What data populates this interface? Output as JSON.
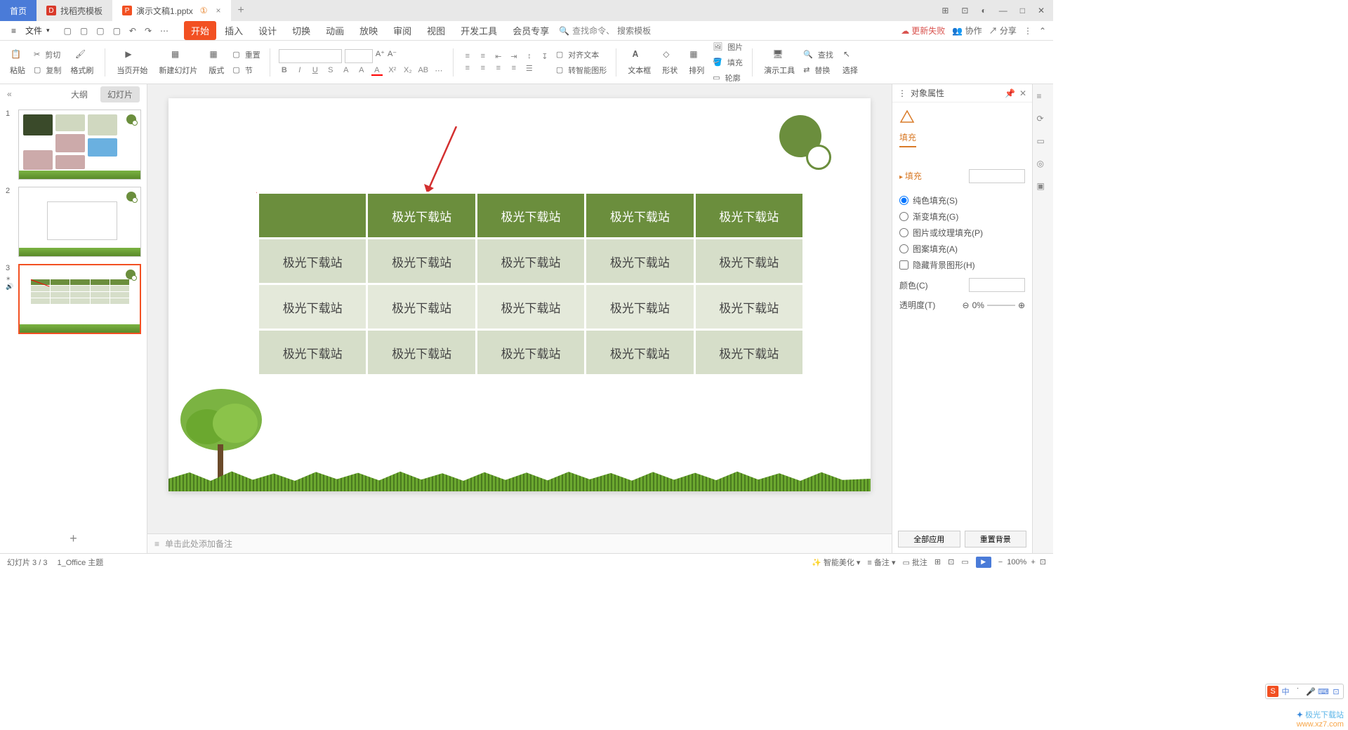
{
  "titlebar": {
    "tabs": [
      {
        "label": "首页",
        "active": true
      },
      {
        "label": "找稻壳模板",
        "icon": "D",
        "iconColor": "#d93a2b"
      },
      {
        "label": "演示文稿1.pptx",
        "icon": "P",
        "iconColor": "#f25022",
        "warn": "①",
        "close": "×"
      }
    ],
    "newtab": "+",
    "right": {
      "layout": "⊞",
      "apps": "⊡",
      "user": "◐",
      "min": "—",
      "max": "□",
      "close": "✕"
    }
  },
  "menubar": {
    "file": "文件",
    "qat": {
      "open": "▢",
      "new": "▢",
      "print": "▢",
      "preview": "▢",
      "undo": "↶",
      "redo": "↷",
      "more": "⋯"
    },
    "tabs": [
      "开始",
      "插入",
      "设计",
      "切换",
      "动画",
      "放映",
      "审阅",
      "视图",
      "开发工具",
      "会员专享"
    ],
    "activeTab": 0,
    "search": {
      "label": "查找命令、",
      "placeholder": "搜索模板"
    },
    "right": {
      "updateFail": "更新失败",
      "collab": "协作",
      "share": "分享"
    }
  },
  "ribbon": {
    "paste": "粘贴",
    "cut": "剪切",
    "copy": "复制",
    "formatPainter": "格式刷",
    "fromCurrent": "当页开始",
    "newSlide": "新建幻灯片",
    "layout": "版式",
    "section": "节",
    "reset": "重置",
    "font": "",
    "fontSize": "",
    "fontUp": "A⁺",
    "fontDown": "A⁻",
    "bold": "B",
    "italic": "I",
    "underline": "U",
    "strike": "S",
    "fontA": "A",
    "fontA2": "A",
    "highlight": "A",
    "fontColor": "A",
    "clearFmt": "X²",
    "sub": "X₂",
    "chCase": "AB",
    "more1": "⋯",
    "alignText": "对齐文本",
    "smartArt": "转智能图形",
    "textbox": "文本框",
    "shape": "形状",
    "arrange": "排列",
    "pic": "图片",
    "fill": "填充",
    "outline": "轮廓",
    "tools": "演示工具",
    "find": "查找",
    "replace": "替换",
    "select": "选择"
  },
  "slidepanel": {
    "outline": "大纲",
    "slides": "幻灯片",
    "collapse": "«",
    "items": [
      {
        "n": "1"
      },
      {
        "n": "2"
      },
      {
        "n": "3"
      }
    ],
    "add": "+"
  },
  "slideTable": {
    "header": [
      "",
      "极光下载站",
      "极光下载站",
      "极光下载站",
      "极光下载站"
    ],
    "rows": [
      [
        "极光下载站",
        "极光下载站",
        "极光下载站",
        "极光下载站",
        "极光下载站"
      ],
      [
        "极光下载站",
        "极光下载站",
        "极光下载站",
        "极光下载站",
        "极光下载站"
      ],
      [
        "极光下载站",
        "极光下载站",
        "极光下载站",
        "极光下载站",
        "极光下载站"
      ]
    ]
  },
  "notes": {
    "placeholder": "单击此处添加备注"
  },
  "rightpanel": {
    "title": "对象属性",
    "pin": "📌",
    "close": "✕",
    "tab": "填充",
    "section": "填充",
    "opts": {
      "solid": "纯色填充(S)",
      "grad": "渐变填充(G)",
      "pic": "图片或纹理填充(P)",
      "patt": "图案填充(A)",
      "hide": "隐藏背景图形(H)"
    },
    "color": "颜色(C)",
    "trans": "透明度(T)",
    "transVal": "0%",
    "applyAll": "全部应用",
    "resetBg": "重置背景"
  },
  "siderail": {
    "i1": "≡",
    "i2": "⟳",
    "i3": "▭",
    "i4": "◎",
    "i5": "▣"
  },
  "statusbar": {
    "slideOf": "幻灯片 3 / 3",
    "theme": "1_Office 主题",
    "beautify": "智能美化",
    "notes": "备注",
    "comments": "批注",
    "views": {
      "normal": "⊞",
      "sorter": "⊡",
      "read": "▭"
    },
    "zoom": {
      "out": "−",
      "val": "100%",
      "in": "+",
      "fit": "⊡"
    }
  },
  "ime": {
    "logo": "S",
    "ch": "中",
    "punct": "˙",
    "mic": "🎤",
    "kbd": "⌨",
    "set": "⊡"
  },
  "watermark": {
    "name": "极光下载站",
    "url": "www.xz7.com"
  }
}
